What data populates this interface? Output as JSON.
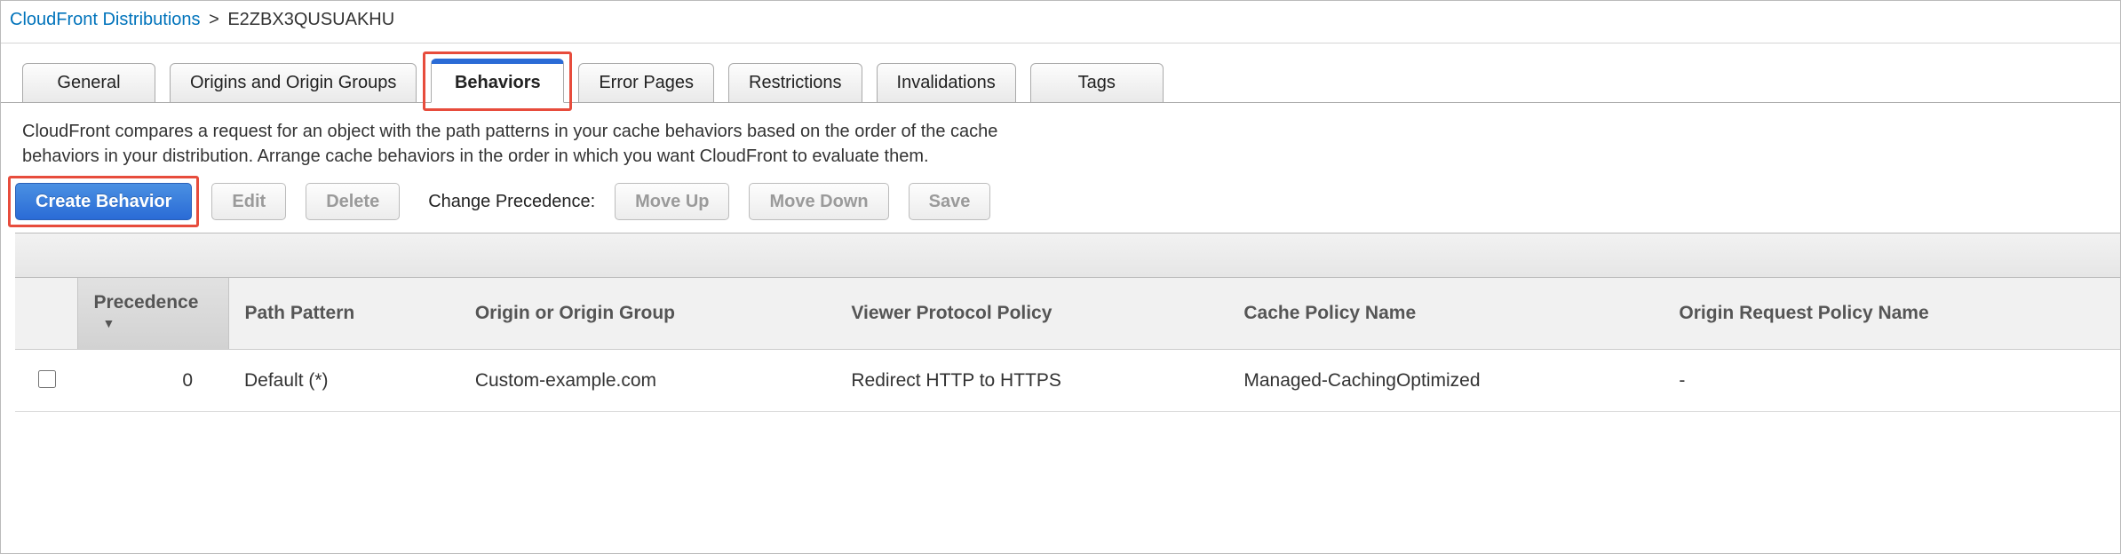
{
  "breadcrumb": {
    "parent": "CloudFront Distributions",
    "current": "E2ZBX3QUSUAKHU",
    "separator": ">"
  },
  "tabs": [
    {
      "label": "General",
      "active": false
    },
    {
      "label": "Origins and Origin Groups",
      "active": false
    },
    {
      "label": "Behaviors",
      "active": true
    },
    {
      "label": "Error Pages",
      "active": false
    },
    {
      "label": "Restrictions",
      "active": false
    },
    {
      "label": "Invalidations",
      "active": false
    },
    {
      "label": "Tags",
      "active": false
    }
  ],
  "description": "CloudFront compares a request for an object with the path patterns in your cache behaviors based on the order of the cache behaviors in your distribution. Arrange cache behaviors in the order in which you want CloudFront to evaluate them.",
  "toolbar": {
    "create": "Create Behavior",
    "edit": "Edit",
    "delete": "Delete",
    "precedence_label": "Change Precedence:",
    "move_up": "Move Up",
    "move_down": "Move Down",
    "save": "Save"
  },
  "table": {
    "headers": {
      "precedence": "Precedence",
      "path_pattern": "Path Pattern",
      "origin": "Origin or Origin Group",
      "viewer_protocol": "Viewer Protocol Policy",
      "cache_policy": "Cache Policy Name",
      "origin_request_policy": "Origin Request Policy Name"
    },
    "rows": [
      {
        "precedence": "0",
        "path_pattern": "Default (*)",
        "origin": "Custom-example.com",
        "viewer_protocol": "Redirect HTTP to HTTPS",
        "cache_policy": "Managed-CachingOptimized",
        "origin_request_policy": "-"
      }
    ]
  }
}
